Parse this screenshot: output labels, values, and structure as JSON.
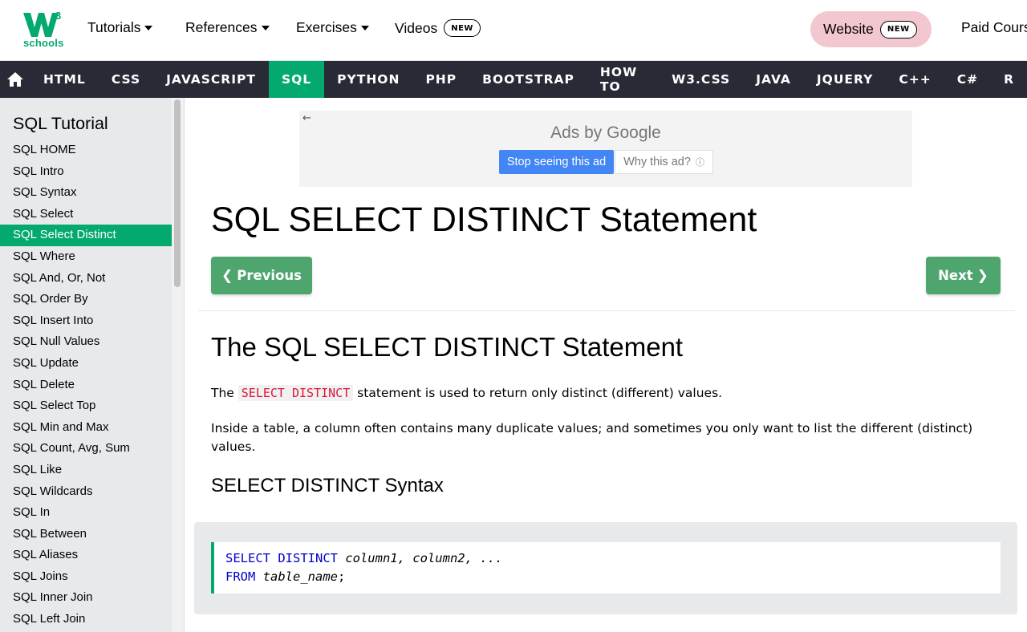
{
  "topbar": {
    "logo_text": "schools",
    "logo_superscript": "3",
    "nav": [
      {
        "label": "Tutorials",
        "dropdown": true
      },
      {
        "label": "References",
        "dropdown": true
      },
      {
        "label": "Exercises",
        "dropdown": true
      },
      {
        "label": "Videos",
        "badge": "NEW"
      }
    ],
    "website_button": {
      "label": "Website",
      "badge": "NEW"
    },
    "paid_courses": "Paid Courses"
  },
  "main_nav": {
    "home_icon": "home-icon",
    "items": [
      "HTML",
      "CSS",
      "JAVASCRIPT",
      "SQL",
      "PYTHON",
      "PHP",
      "BOOTSTRAP",
      "HOW TO",
      "W3.CSS",
      "JAVA",
      "JQUERY",
      "C++",
      "C#",
      "R"
    ],
    "active": "SQL"
  },
  "sidebar": {
    "title": "SQL Tutorial",
    "items": [
      "SQL HOME",
      "SQL Intro",
      "SQL Syntax",
      "SQL Select",
      "SQL Select Distinct",
      "SQL Where",
      "SQL And, Or, Not",
      "SQL Order By",
      "SQL Insert Into",
      "SQL Null Values",
      "SQL Update",
      "SQL Delete",
      "SQL Select Top",
      "SQL Min and Max",
      "SQL Count, Avg, Sum",
      "SQL Like",
      "SQL Wildcards",
      "SQL In",
      "SQL Between",
      "SQL Aliases",
      "SQL Joins",
      "SQL Inner Join",
      "SQL Left Join"
    ],
    "active": "SQL Select Distinct"
  },
  "ad": {
    "back": "←",
    "ads_by": "Ads by Google",
    "stop_label": "Stop seeing this ad",
    "why_label": "Why this ad?",
    "info": "ⓘ"
  },
  "content": {
    "title": "SQL SELECT DISTINCT Statement",
    "prev_label": "Previous",
    "next_label": "Next",
    "section_title": "The SQL SELECT DISTINCT Statement",
    "p1_before": "The ",
    "p1_code": "SELECT DISTINCT",
    "p1_after": " statement is used to return only distinct (different) values.",
    "p2": "Inside a table, a column often contains many duplicate values; and sometimes you only want to list the different (distinct) values.",
    "syntax_title": "SELECT DISTINCT Syntax",
    "code": {
      "line1_kw": "SELECT DISTINCT",
      "line1_rest": " column1, column2, ...",
      "line2_kw": "FROM",
      "line2_rest": " table_name",
      "line2_end": ";"
    }
  },
  "colors": {
    "accent": "#04AA6D",
    "nav_bg": "#282A35",
    "sidebar_bg": "#E7E9EB",
    "website_bg": "#f3c7cf"
  }
}
